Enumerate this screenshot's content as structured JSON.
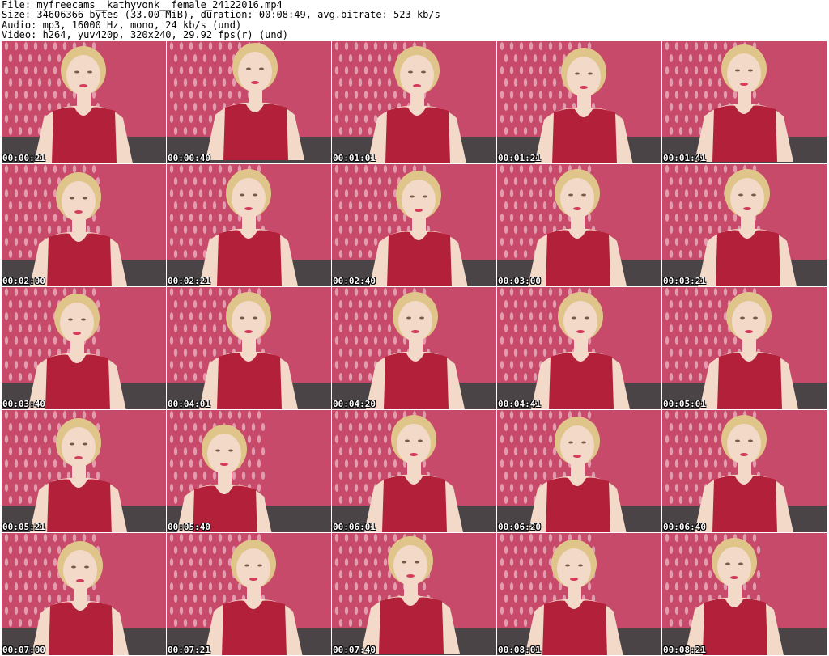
{
  "header": {
    "line1": "File: myfreecams__kathyvonk__female_24122016.mp4",
    "line2": "Size: 34606366 bytes (33.00 MiB), duration: 00:08:49, avg.bitrate: 523 kb/s",
    "line3": "Audio: mp3, 16000 Hz, mono, 24 kb/s (und)",
    "line4": "Video: h264, yuv420p, 320x240, 29.92 fps(r) (und)"
  },
  "frames": [
    {
      "time": "00:00:21"
    },
    {
      "time": "00:00:40"
    },
    {
      "time": "00:01:01"
    },
    {
      "time": "00:01:21"
    },
    {
      "time": "00:01:41"
    },
    {
      "time": "00:02:00"
    },
    {
      "time": "00:02:21"
    },
    {
      "time": "00:02:40"
    },
    {
      "time": "00:03:00"
    },
    {
      "time": "00:03:21"
    },
    {
      "time": "00:03:40"
    },
    {
      "time": "00:04:01"
    },
    {
      "time": "00:04:20"
    },
    {
      "time": "00:04:41"
    },
    {
      "time": "00:05:01"
    },
    {
      "time": "00:05:21"
    },
    {
      "time": "00:05:40"
    },
    {
      "time": "00:06:01"
    },
    {
      "time": "00:06:20"
    },
    {
      "time": "00:06:40"
    },
    {
      "time": "00:07:00"
    },
    {
      "time": "00:07:21"
    },
    {
      "time": "00:07:40"
    },
    {
      "time": "00:08:01"
    },
    {
      "time": "00:08:21"
    }
  ],
  "colors": {
    "wall": "#c84a6a",
    "wall_pattern": "#e9b9c6",
    "dress": "#b3203a",
    "skin": "#f2d9c8",
    "hair": "#e0c58a",
    "couch": "#4a4446"
  }
}
